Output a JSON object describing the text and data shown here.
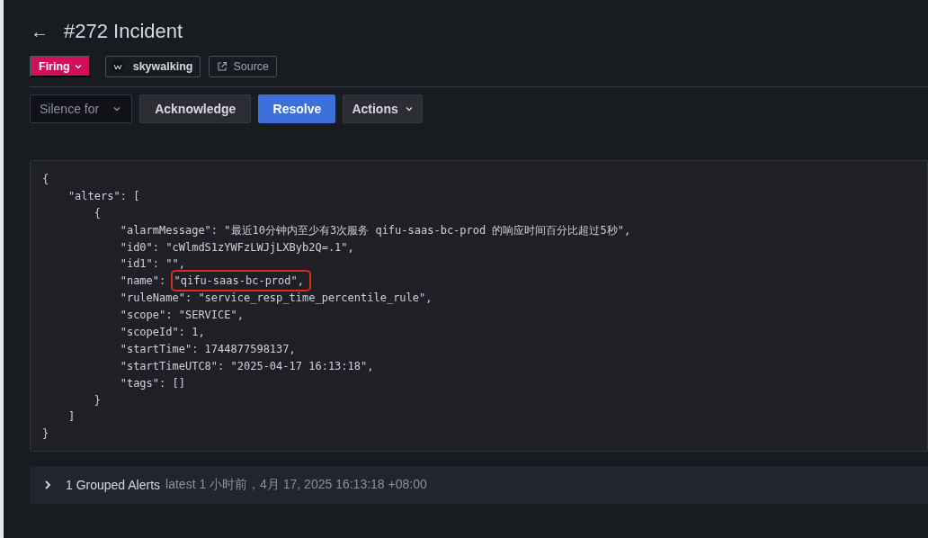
{
  "header": {
    "back": "←",
    "title": "#272 Incident"
  },
  "tags": [
    {
      "kind": "status",
      "label": "Firing"
    },
    {
      "kind": "integration",
      "label": "skywalking"
    },
    {
      "kind": "link",
      "label": "Source"
    }
  ],
  "actions": [
    {
      "kind": "select",
      "label": "Silence for"
    },
    {
      "kind": "secondary",
      "label": "Acknowledge"
    },
    {
      "kind": "primary",
      "label": "Resolve"
    },
    {
      "kind": "menu",
      "label": "Actions"
    }
  ],
  "payload": {
    "lines": [
      {
        "text": "{"
      },
      {
        "text": "    \"alters\": ["
      },
      {
        "text": "        {"
      },
      {
        "text": "            \"alarmMessage\": \"最近10分钟内至少有3次服务 qifu-saas-bc-prod 的响应时间百分比超过5秒\","
      },
      {
        "text": "            \"id0\": \"cWlmdS1zYWFzLWJjLXByb2Q=.1\","
      },
      {
        "text": "            \"id1\": \"\","
      },
      {
        "text": "            \"name\": ",
        "marked": "\"qifu-saas-bc-prod\","
      },
      {
        "text": "            \"ruleName\": \"service_resp_time_percentile_rule\","
      },
      {
        "text": "            \"scope\": \"SERVICE\","
      },
      {
        "text": "            \"scopeId\": 1,"
      },
      {
        "text": "            \"startTime\": 1744877598137,"
      },
      {
        "text": "            \"startTimeUTC8\": \"2025-04-17 16:13:18\","
      },
      {
        "text": "            \"tags\": []"
      },
      {
        "text": "        }"
      },
      {
        "text": "    ]"
      },
      {
        "text": "}"
      }
    ]
  },
  "grouped": {
    "expanded": false,
    "title": "1 Grouped Alerts",
    "latest": "latest 1 小时前，4月 17, 2025 16:13:18 +08:00"
  }
}
